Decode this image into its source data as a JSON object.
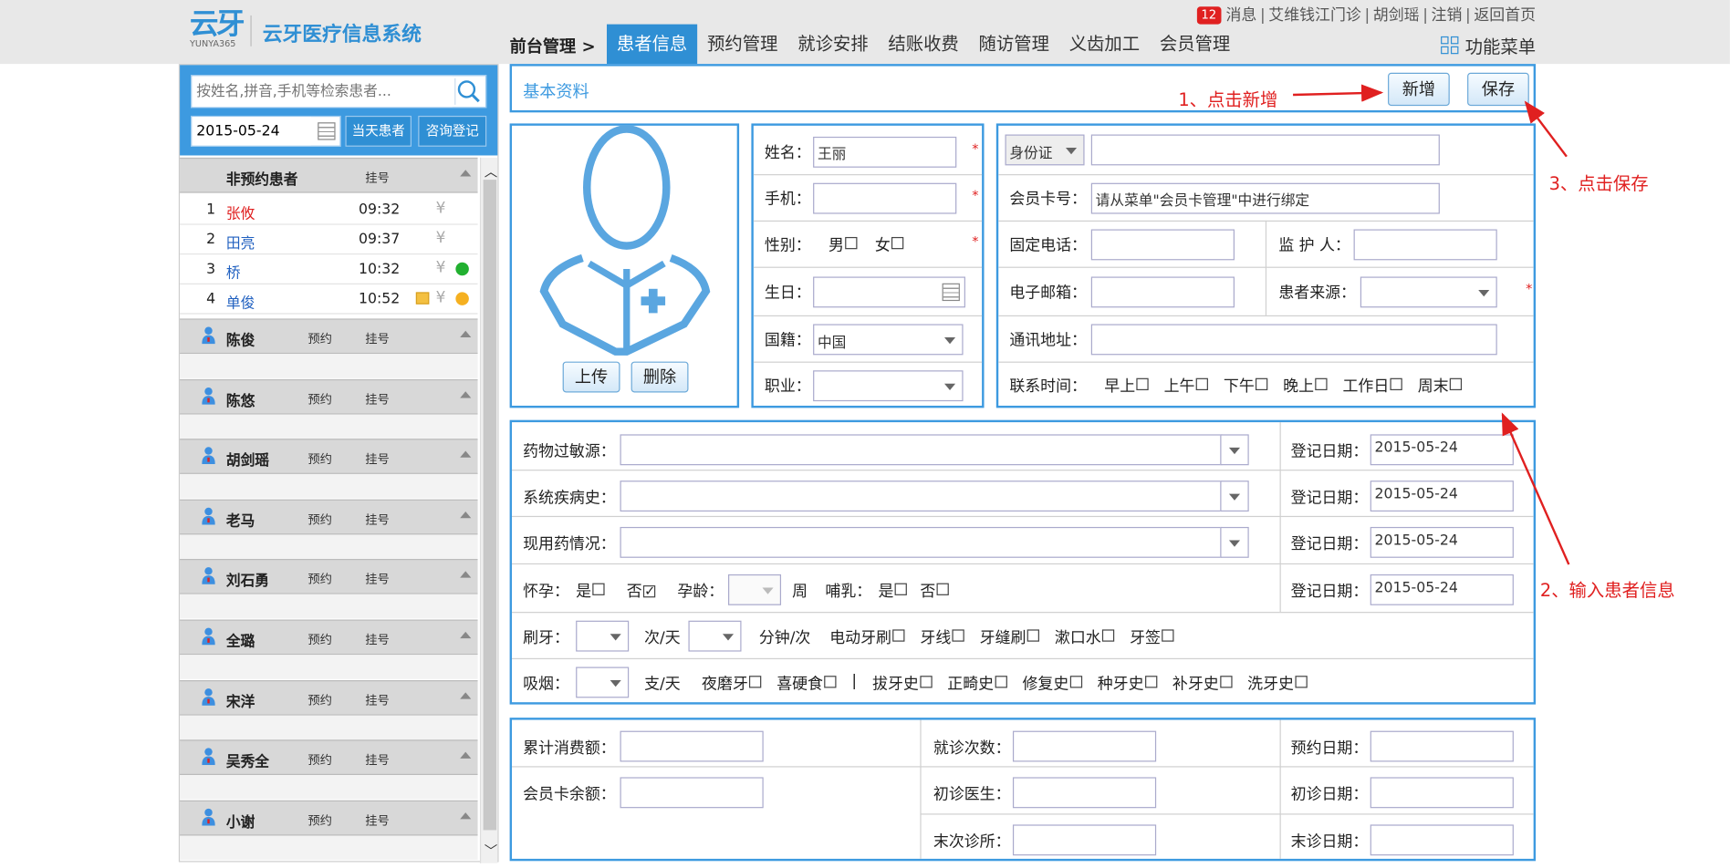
{
  "app": {
    "logo_mark": "云牙",
    "logo_sub": "YUNYA365",
    "title": "云牙医疗信息系统"
  },
  "toplinks": {
    "msg_count": "12",
    "messages": "消息",
    "clinic": "艾维钱江门诊",
    "user": "胡剑瑶",
    "logout": "注销",
    "home": "返回首页"
  },
  "nav": {
    "path": "前台管理 >",
    "tabs": [
      "患者信息",
      "预约管理",
      "就诊安排",
      "结账收费",
      "随访管理",
      "义齿加工",
      "会员管理"
    ],
    "active": 0,
    "func_menu": "功能菜单"
  },
  "sidebar": {
    "search_placeholder": "按姓名,拼音,手机等检索患者...",
    "date": "2015-05-24",
    "today_btn": "当天患者",
    "consult_btn": "咨询登记",
    "nonappt": {
      "title": "非预约患者",
      "col": "挂号"
    },
    "patients": [
      {
        "no": "1",
        "name": "张攸",
        "time": "09:32",
        "color": "#e02020"
      },
      {
        "no": "2",
        "name": "田亮",
        "time": "09:37",
        "color": "#2060c0"
      },
      {
        "no": "3",
        "name": "桥",
        "time": "10:32",
        "color": "#2060c0"
      },
      {
        "no": "4",
        "name": "单俊",
        "time": "10:52",
        "color": "#2060c0"
      }
    ],
    "yen": "¥",
    "doctor_cols": {
      "a": "预约",
      "b": "挂号"
    },
    "doctors": [
      "陈俊",
      "陈悠",
      "胡剑瑶",
      "老马",
      "刘石勇",
      "全璐",
      "宋洋",
      "吴秀全",
      "小谢"
    ]
  },
  "header": {
    "title": "基本资料",
    "new_btn": "新增",
    "save_btn": "保存"
  },
  "photo": {
    "upload": "上传",
    "delete": "删除"
  },
  "basic": {
    "name_label": "姓名：",
    "name_value": "王丽",
    "phone_label": "手机：",
    "gender_label": "性别：",
    "male": "男",
    "female": "女",
    "birth_label": "生日：",
    "nation_label": "国籍：",
    "nation_value": "中国",
    "job_label": "职业："
  },
  "contact": {
    "id_type": "身份证",
    "member_label": "会员卡号：",
    "member_value": "请从菜单\"会员卡管理\"中进行绑定",
    "tel_label": "固定电话：",
    "guardian_label": "监 护 人：",
    "email_label": "电子邮箱：",
    "source_label": "患者来源：",
    "address_label": "通讯地址：",
    "time_label": "联系时间：",
    "times": [
      "早上",
      "上午",
      "下午",
      "晚上",
      "工作日",
      "周末"
    ]
  },
  "medical": {
    "allergy_label": "药物过敏源：",
    "history_label": "系统疾病史：",
    "meds_label": "现用药情况：",
    "reg_label": "登记日期：",
    "reg_date": "2015-05-24",
    "preg_label": "怀孕：",
    "yes": "是",
    "no": "否",
    "preg_age": "孕龄：",
    "week": "周",
    "nurse_label": "哺乳：",
    "brush_label": "刷牙：",
    "times_day": "次/天",
    "min_time": "分钟/次",
    "brush_items": [
      "电动牙刷",
      "牙线",
      "牙缝刷",
      "漱口水",
      "牙签"
    ],
    "smoke_label": "吸烟：",
    "per_day": "支/天",
    "smoke_items": [
      "夜磨牙",
      "喜硬食"
    ],
    "divider": "|",
    "history_items": [
      "拔牙史",
      "正畸史",
      "修复史",
      "种牙史",
      "补牙史",
      "洗牙史"
    ]
  },
  "account": {
    "total_label": "累计消费额：",
    "balance_label": "会员卡余额：",
    "visits_label": "就诊次数：",
    "first_doc_label": "初诊医生：",
    "last_clinic_label": "末次诊所：",
    "appt_label": "预约日期：",
    "first_date_label": "初诊日期：",
    "last_date_label": "末诊日期："
  },
  "annotations": {
    "step1": "1、点击新增",
    "step2": "2、输入患者信息",
    "step3": "3、点击保存"
  }
}
